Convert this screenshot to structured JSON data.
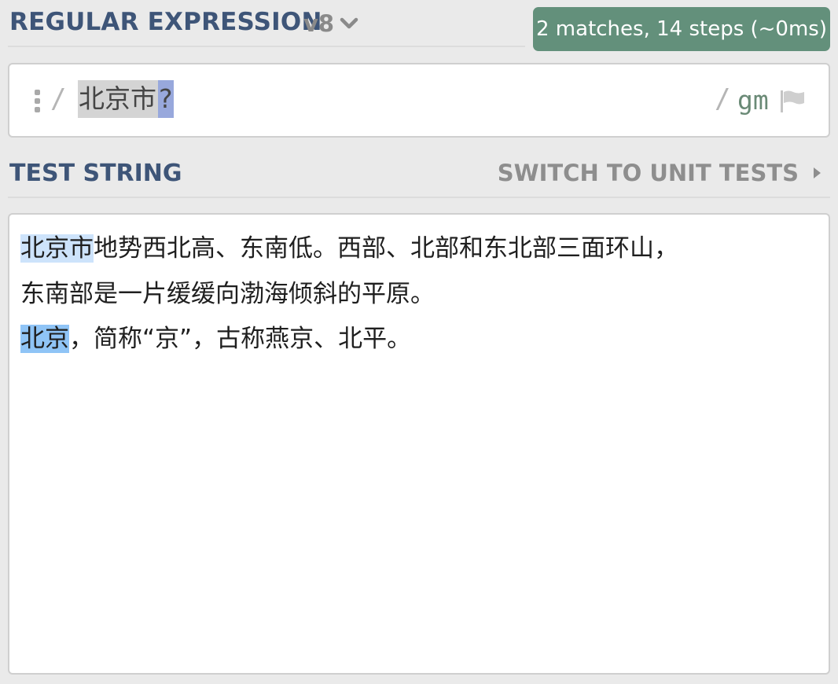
{
  "header": {
    "title": "REGULAR EXPRESSION",
    "flavor": "v8",
    "match_info": "2 matches, 14 steps (~0ms)"
  },
  "regex": {
    "open_delimiter": "/",
    "pattern_literal": "北京市",
    "pattern_quantifier": "?",
    "close_delimiter": "/",
    "flags": "gm"
  },
  "test_section": {
    "title": "TEST STRING",
    "switch_label": "SWITCH TO UNIT TESTS",
    "lines": [
      {
        "match": "北京市",
        "rest": "地势西北高、东南低。西部、北部和东北部三面环山，"
      },
      {
        "text": "东南部是一片缓缓向渤海倾斜的平原。"
      },
      {
        "match": "北京",
        "rest": "，简称“京”，古称燕京、北平。"
      }
    ]
  },
  "colors": {
    "heading": "#3e5578",
    "badge_bg": "#63907b",
    "flags": "#6a8a76",
    "match_highlight_1": "#cde3fb",
    "match_highlight_2": "#8fc4f6",
    "quantifier_highlight": "#98a8dc"
  },
  "icons": {
    "flavor_toggle": "chevron-down-icon",
    "drag": "drag-handle-icon",
    "flags_menu": "flag-icon",
    "switch_arrow": "chevron-right-icon"
  }
}
